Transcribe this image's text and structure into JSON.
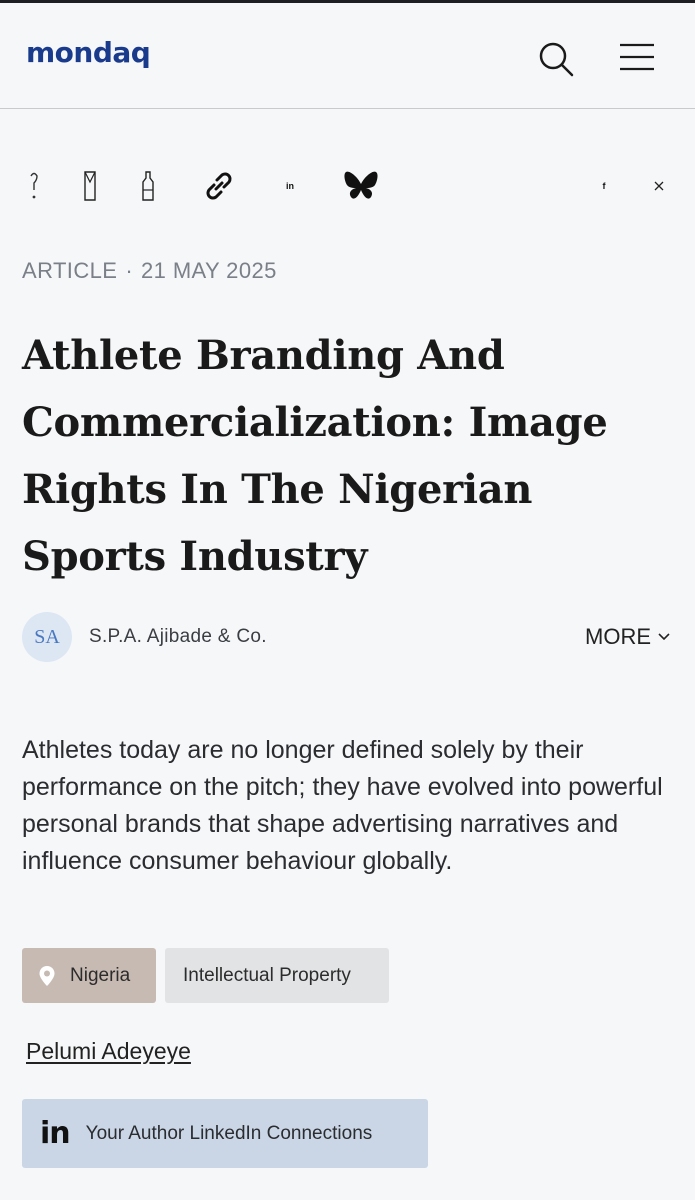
{
  "header": {
    "logo_text": "mondaq",
    "logo_color": "#1a3b8c",
    "search_icon": "search-icon",
    "menu_icon": "hamburger-menu-icon"
  },
  "share_icons": [
    {
      "name": "question-icon",
      "glyph": "?"
    },
    {
      "name": "glass-icon",
      "glyph": "⧗"
    },
    {
      "name": "bottle-icon",
      "glyph": "⬚"
    },
    {
      "name": "link-icon"
    },
    {
      "name": "linkedin-share-icon",
      "glyph": "in"
    },
    {
      "name": "bluesky-icon"
    },
    {
      "name": "facebook-icon",
      "glyph": "f"
    },
    {
      "name": "x-icon",
      "glyph": "𝕏"
    }
  ],
  "article": {
    "type": "ARTICLE",
    "separator": "·",
    "date": "21 MAY 2025",
    "title": "Athlete Branding And Commercialization: Image Rights In The Nigerian Sports Industry",
    "firm_initials": "SA",
    "firm_name": "S.P.A. Ajibade & Co.",
    "more_label": "MORE",
    "lead": "Athletes today are no longer defined solely by their performance on the pitch; they have evolved into powerful personal brands that shape advertising narratives and influence consumer behaviour globally.",
    "tags": {
      "country": "Nigeria",
      "topic": "Intellectual Property"
    },
    "author": "Pelumi Adeyeye",
    "linkedin_label": "Your Author LinkedIn Connections"
  },
  "colors": {
    "country_tag_bg": "#c7bab3",
    "topic_tag_bg": "#e2e3e5",
    "linkedin_btn_bg": "#cad6e6",
    "avatar_bg": "#dde6f3"
  }
}
